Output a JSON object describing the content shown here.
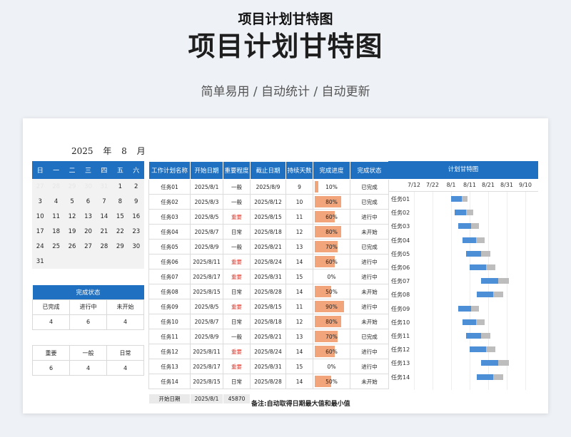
{
  "header": {
    "title": "项目计划甘特图",
    "subtitle": "简单易用  /  自动统计  /  自动更新"
  },
  "sheet": {
    "title": "项目计划甘特图"
  },
  "calendar": {
    "year_month": "2025  年  8  月",
    "weekdays": [
      "日",
      "一",
      "二",
      "三",
      "四",
      "五",
      "六"
    ],
    "weeks": [
      [
        {
          "d": "27",
          "g": true
        },
        {
          "d": "28",
          "g": true
        },
        {
          "d": "29",
          "g": true
        },
        {
          "d": "30",
          "g": true
        },
        {
          "d": "31",
          "g": true
        },
        {
          "d": "1"
        },
        {
          "d": "2"
        }
      ],
      [
        {
          "d": "3"
        },
        {
          "d": "4"
        },
        {
          "d": "5"
        },
        {
          "d": "6"
        },
        {
          "d": "7"
        },
        {
          "d": "8"
        },
        {
          "d": "9"
        }
      ],
      [
        {
          "d": "10"
        },
        {
          "d": "11"
        },
        {
          "d": "12"
        },
        {
          "d": "13"
        },
        {
          "d": "14"
        },
        {
          "d": "15"
        },
        {
          "d": "16"
        }
      ],
      [
        {
          "d": "17"
        },
        {
          "d": "18"
        },
        {
          "d": "19"
        },
        {
          "d": "20"
        },
        {
          "d": "21"
        },
        {
          "d": "22"
        },
        {
          "d": "23"
        }
      ],
      [
        {
          "d": "24"
        },
        {
          "d": "25"
        },
        {
          "d": "26"
        },
        {
          "d": "27"
        },
        {
          "d": "28"
        },
        {
          "d": "29"
        },
        {
          "d": "30"
        }
      ],
      [
        {
          "d": "31"
        },
        {
          "d": ""
        },
        {
          "d": ""
        },
        {
          "d": ""
        },
        {
          "d": ""
        },
        {
          "d": ""
        },
        {
          "d": ""
        }
      ]
    ]
  },
  "status_summary": {
    "title": "完成状态",
    "labels": [
      "已完成",
      "进行中",
      "未开始"
    ],
    "values": [
      "4",
      "6",
      "4"
    ]
  },
  "priority_summary": {
    "labels": [
      "重要",
      "一般",
      "日常"
    ],
    "values": [
      "6",
      "4",
      "4"
    ]
  },
  "table": {
    "headers": [
      "工作计划名称",
      "开始日期",
      "重要程度",
      "截止日期",
      "持续天数",
      "完成进度",
      "完成状态"
    ],
    "rows": [
      {
        "name": "任务01",
        "start": "2025/8/1",
        "priority": "一般",
        "end": "2025/8/9",
        "days": "9",
        "progress": "10%",
        "pct": 0.1,
        "status": "已完成"
      },
      {
        "name": "任务02",
        "start": "2025/8/3",
        "priority": "一般",
        "end": "2025/8/12",
        "days": "10",
        "progress": "80%",
        "pct": 0.8,
        "status": "已完成"
      },
      {
        "name": "任务03",
        "start": "2025/8/5",
        "priority": "重要",
        "end": "2025/8/15",
        "days": "11",
        "progress": "60%",
        "pct": 0.6,
        "status": "进行中"
      },
      {
        "name": "任务04",
        "start": "2025/8/7",
        "priority": "日常",
        "end": "2025/8/18",
        "days": "12",
        "progress": "80%",
        "pct": 0.8,
        "status": "未开始"
      },
      {
        "name": "任务05",
        "start": "2025/8/9",
        "priority": "一般",
        "end": "2025/8/21",
        "days": "13",
        "progress": "70%",
        "pct": 0.7,
        "status": "已完成"
      },
      {
        "name": "任务06",
        "start": "2025/8/11",
        "priority": "重要",
        "end": "2025/8/24",
        "days": "14",
        "progress": "60%",
        "pct": 0.6,
        "status": "进行中"
      },
      {
        "name": "任务07",
        "start": "2025/8/17",
        "priority": "重要",
        "end": "2025/8/31",
        "days": "15",
        "progress": "0%",
        "pct": 0.0,
        "status": "进行中"
      },
      {
        "name": "任务08",
        "start": "2025/8/15",
        "priority": "日常",
        "end": "2025/8/28",
        "days": "14",
        "progress": "50%",
        "pct": 0.5,
        "status": "未开始"
      },
      {
        "name": "任务09",
        "start": "2025/8/5",
        "priority": "重要",
        "end": "2025/8/15",
        "days": "11",
        "progress": "90%",
        "pct": 0.9,
        "status": "进行中"
      },
      {
        "name": "任务10",
        "start": "2025/8/7",
        "priority": "日常",
        "end": "2025/8/18",
        "days": "12",
        "progress": "80%",
        "pct": 0.8,
        "status": "未开始"
      },
      {
        "name": "任务11",
        "start": "2025/8/9",
        "priority": "一般",
        "end": "2025/8/21",
        "days": "13",
        "progress": "70%",
        "pct": 0.7,
        "status": "已完成"
      },
      {
        "name": "任务12",
        "start": "2025/8/11",
        "priority": "重要",
        "end": "2025/8/24",
        "days": "14",
        "progress": "60%",
        "pct": 0.6,
        "status": "进行中"
      },
      {
        "name": "任务13",
        "start": "2025/8/17",
        "priority": "重要",
        "end": "2025/8/31",
        "days": "15",
        "progress": "0%",
        "pct": 0.0,
        "status": "进行中"
      },
      {
        "name": "任务14",
        "start": "2025/8/15",
        "priority": "日常",
        "end": "2025/8/28",
        "days": "14",
        "progress": "50%",
        "pct": 0.5,
        "status": "未开始"
      }
    ],
    "important_value": "重要"
  },
  "footer": {
    "label": "开始日期",
    "date": "2025/8/1",
    "serial": "45870",
    "note": "备注:自动取得日期最大值和最小值"
  },
  "gantt": {
    "title": "计划甘特图",
    "axis_labels": [
      "7/12",
      "7/22",
      "8/1",
      "8/11",
      "8/21",
      "8/31",
      "9/10"
    ],
    "colors": {
      "plan": "#bdbdbd",
      "done": "#4d8fd6"
    }
  },
  "colors": {
    "header_blue": "#1f70c1",
    "progress_fill": "#f2a57b",
    "important_red": "#e03a2f"
  }
}
